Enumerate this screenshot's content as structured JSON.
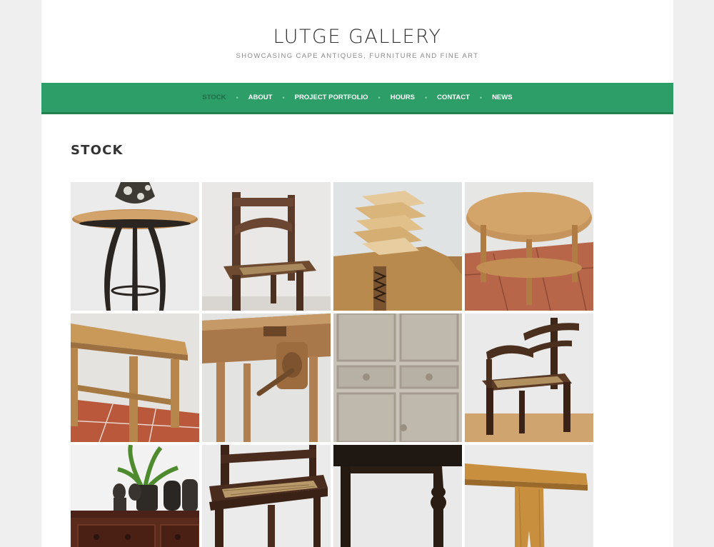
{
  "site": {
    "title": "LUTGE GALLERY",
    "tagline": "SHOWCASING CAPE ANTIQUES, FURNITURE AND FINE ART"
  },
  "nav": {
    "items": [
      {
        "label": "STOCK",
        "active": true
      },
      {
        "label": "ABOUT"
      },
      {
        "label": "PROJECT PORTFOLIO"
      },
      {
        "label": "HOURS"
      },
      {
        "label": "CONTACT"
      },
      {
        "label": "NEWS"
      }
    ],
    "separator": "•"
  },
  "page": {
    "title": "STOCK"
  },
  "colors": {
    "accent": "#2e9e68",
    "nav_active": "#1f6b45",
    "background": "#efefef"
  },
  "gallery": {
    "items": [
      {
        "subject": "round-table-with-vase"
      },
      {
        "subject": "wooden-chair"
      },
      {
        "subject": "stacked-boards"
      },
      {
        "subject": "round-pine-table"
      },
      {
        "subject": "pine-table"
      },
      {
        "subject": "workbench-vice"
      },
      {
        "subject": "cupboard-doors"
      },
      {
        "subject": "armchair"
      },
      {
        "subject": "sideboard-with-figures"
      },
      {
        "subject": "riempie-chair"
      },
      {
        "subject": "dark-table-leg"
      },
      {
        "subject": "pine-bench"
      }
    ]
  }
}
